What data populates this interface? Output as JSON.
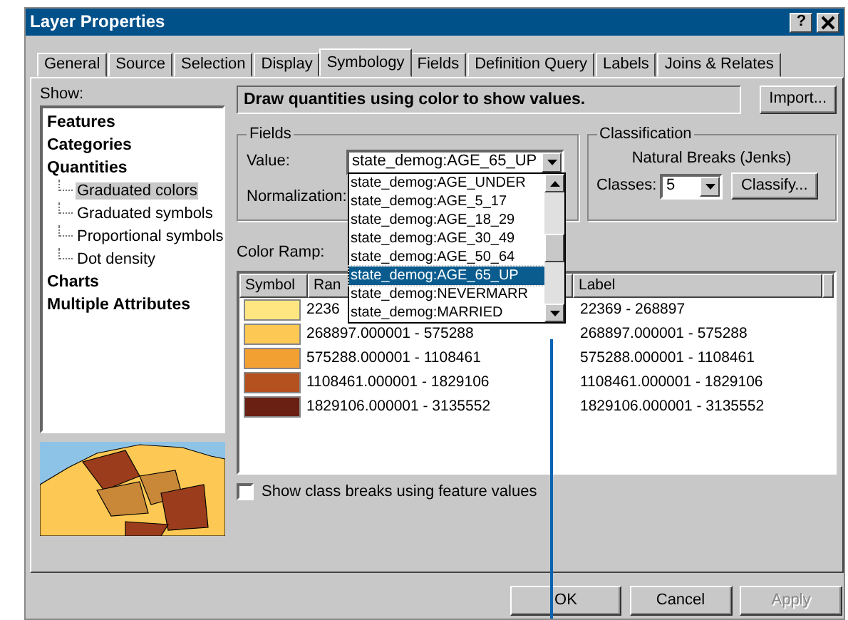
{
  "window": {
    "title": "Layer Properties",
    "help": "?"
  },
  "tabs": [
    {
      "label": "General",
      "selected": false
    },
    {
      "label": "Source",
      "selected": false
    },
    {
      "label": "Selection",
      "selected": false
    },
    {
      "label": "Display",
      "selected": false
    },
    {
      "label": "Symbology",
      "selected": true
    },
    {
      "label": "Fields",
      "selected": false
    },
    {
      "label": "Definition Query",
      "selected": false
    },
    {
      "label": "Labels",
      "selected": false
    },
    {
      "label": "Joins & Relates",
      "selected": false
    }
  ],
  "show": {
    "label": "Show:",
    "items": [
      {
        "label": "Features",
        "selected": false
      },
      {
        "label": "Categories",
        "selected": false
      },
      {
        "label": "Quantities",
        "selected": false,
        "children": [
          {
            "label": "Graduated colors",
            "selected": true
          },
          {
            "label": "Graduated symbols",
            "selected": false
          },
          {
            "label": "Proportional symbols",
            "selected": false
          },
          {
            "label": "Dot density",
            "selected": false
          }
        ]
      },
      {
        "label": "Charts",
        "selected": false
      },
      {
        "label": "Multiple Attributes",
        "selected": false
      }
    ]
  },
  "description": "Draw quantities using color to show values.",
  "import_button": "Import...",
  "fields": {
    "title": "Fields",
    "value_label": "Value:",
    "value": "state_demog:AGE_65_UP",
    "normalization_label": "Normalization:",
    "dropdown": [
      {
        "label": "state_demog:AGE_UNDER",
        "selected": false
      },
      {
        "label": "state_demog:AGE_5_17",
        "selected": false
      },
      {
        "label": "state_demog:AGE_18_29",
        "selected": false
      },
      {
        "label": "state_demog:AGE_30_49",
        "selected": false
      },
      {
        "label": "state_demog:AGE_50_64",
        "selected": false
      },
      {
        "label": "state_demog:AGE_65_UP",
        "selected": true
      },
      {
        "label": "state_demog:NEVERMARR",
        "selected": false
      },
      {
        "label": "state_demog:MARRIED",
        "selected": false
      }
    ]
  },
  "classification": {
    "title": "Classification",
    "method": "Natural Breaks (Jenks)",
    "classes_label": "Classes:",
    "classes": "5",
    "classify_button": "Classify..."
  },
  "color_ramp_label": "Color Ramp:",
  "table": {
    "columns": [
      "Symbol",
      "Ran",
      "Label"
    ],
    "rows": [
      {
        "color": "#ffe680",
        "range": "2236",
        "label": "22369 - 268897"
      },
      {
        "color": "#fdc853",
        "range": "268897.000001 - 575288",
        "label": "268897.000001 - 575288"
      },
      {
        "color": "#f3a032",
        "range": "575288.000001 - 1108461",
        "label": "575288.000001 - 1108461"
      },
      {
        "color": "#b5511f",
        "range": "1108461.000001 - 1829106",
        "label": "1108461.000001 - 1829106"
      },
      {
        "color": "#6a2012",
        "range": "1829106.000001 - 3135552",
        "label": "1829106.000001 - 3135552"
      }
    ]
  },
  "checkbox": {
    "label": "Show class breaks using feature values",
    "checked": false
  },
  "buttons": [
    {
      "label": "OK",
      "disabled": false
    },
    {
      "label": "Cancel",
      "disabled": false
    },
    {
      "label": "Apply",
      "disabled": true
    }
  ]
}
